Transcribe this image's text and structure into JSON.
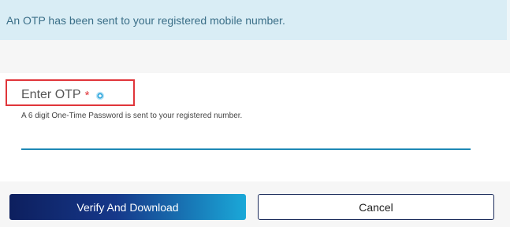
{
  "alert": {
    "message": "An OTP has been sent to your registered mobile number."
  },
  "otp_field": {
    "label": "Enter OTP",
    "required_marker": "*",
    "info_icon": "info-circle-icon",
    "hint": "A 6 digit One-Time Password is sent to your registered number.",
    "value": "",
    "placeholder": ""
  },
  "buttons": {
    "verify_label": "Verify And Download",
    "cancel_label": "Cancel"
  },
  "colors": {
    "alert_bg": "#d9edf5",
    "alert_text": "#3b6f88",
    "highlight_border": "#e0353a",
    "input_underline": "#1e88b5",
    "primary_gradient_start": "#0d1f5e",
    "primary_gradient_end": "#1aa8d8"
  }
}
